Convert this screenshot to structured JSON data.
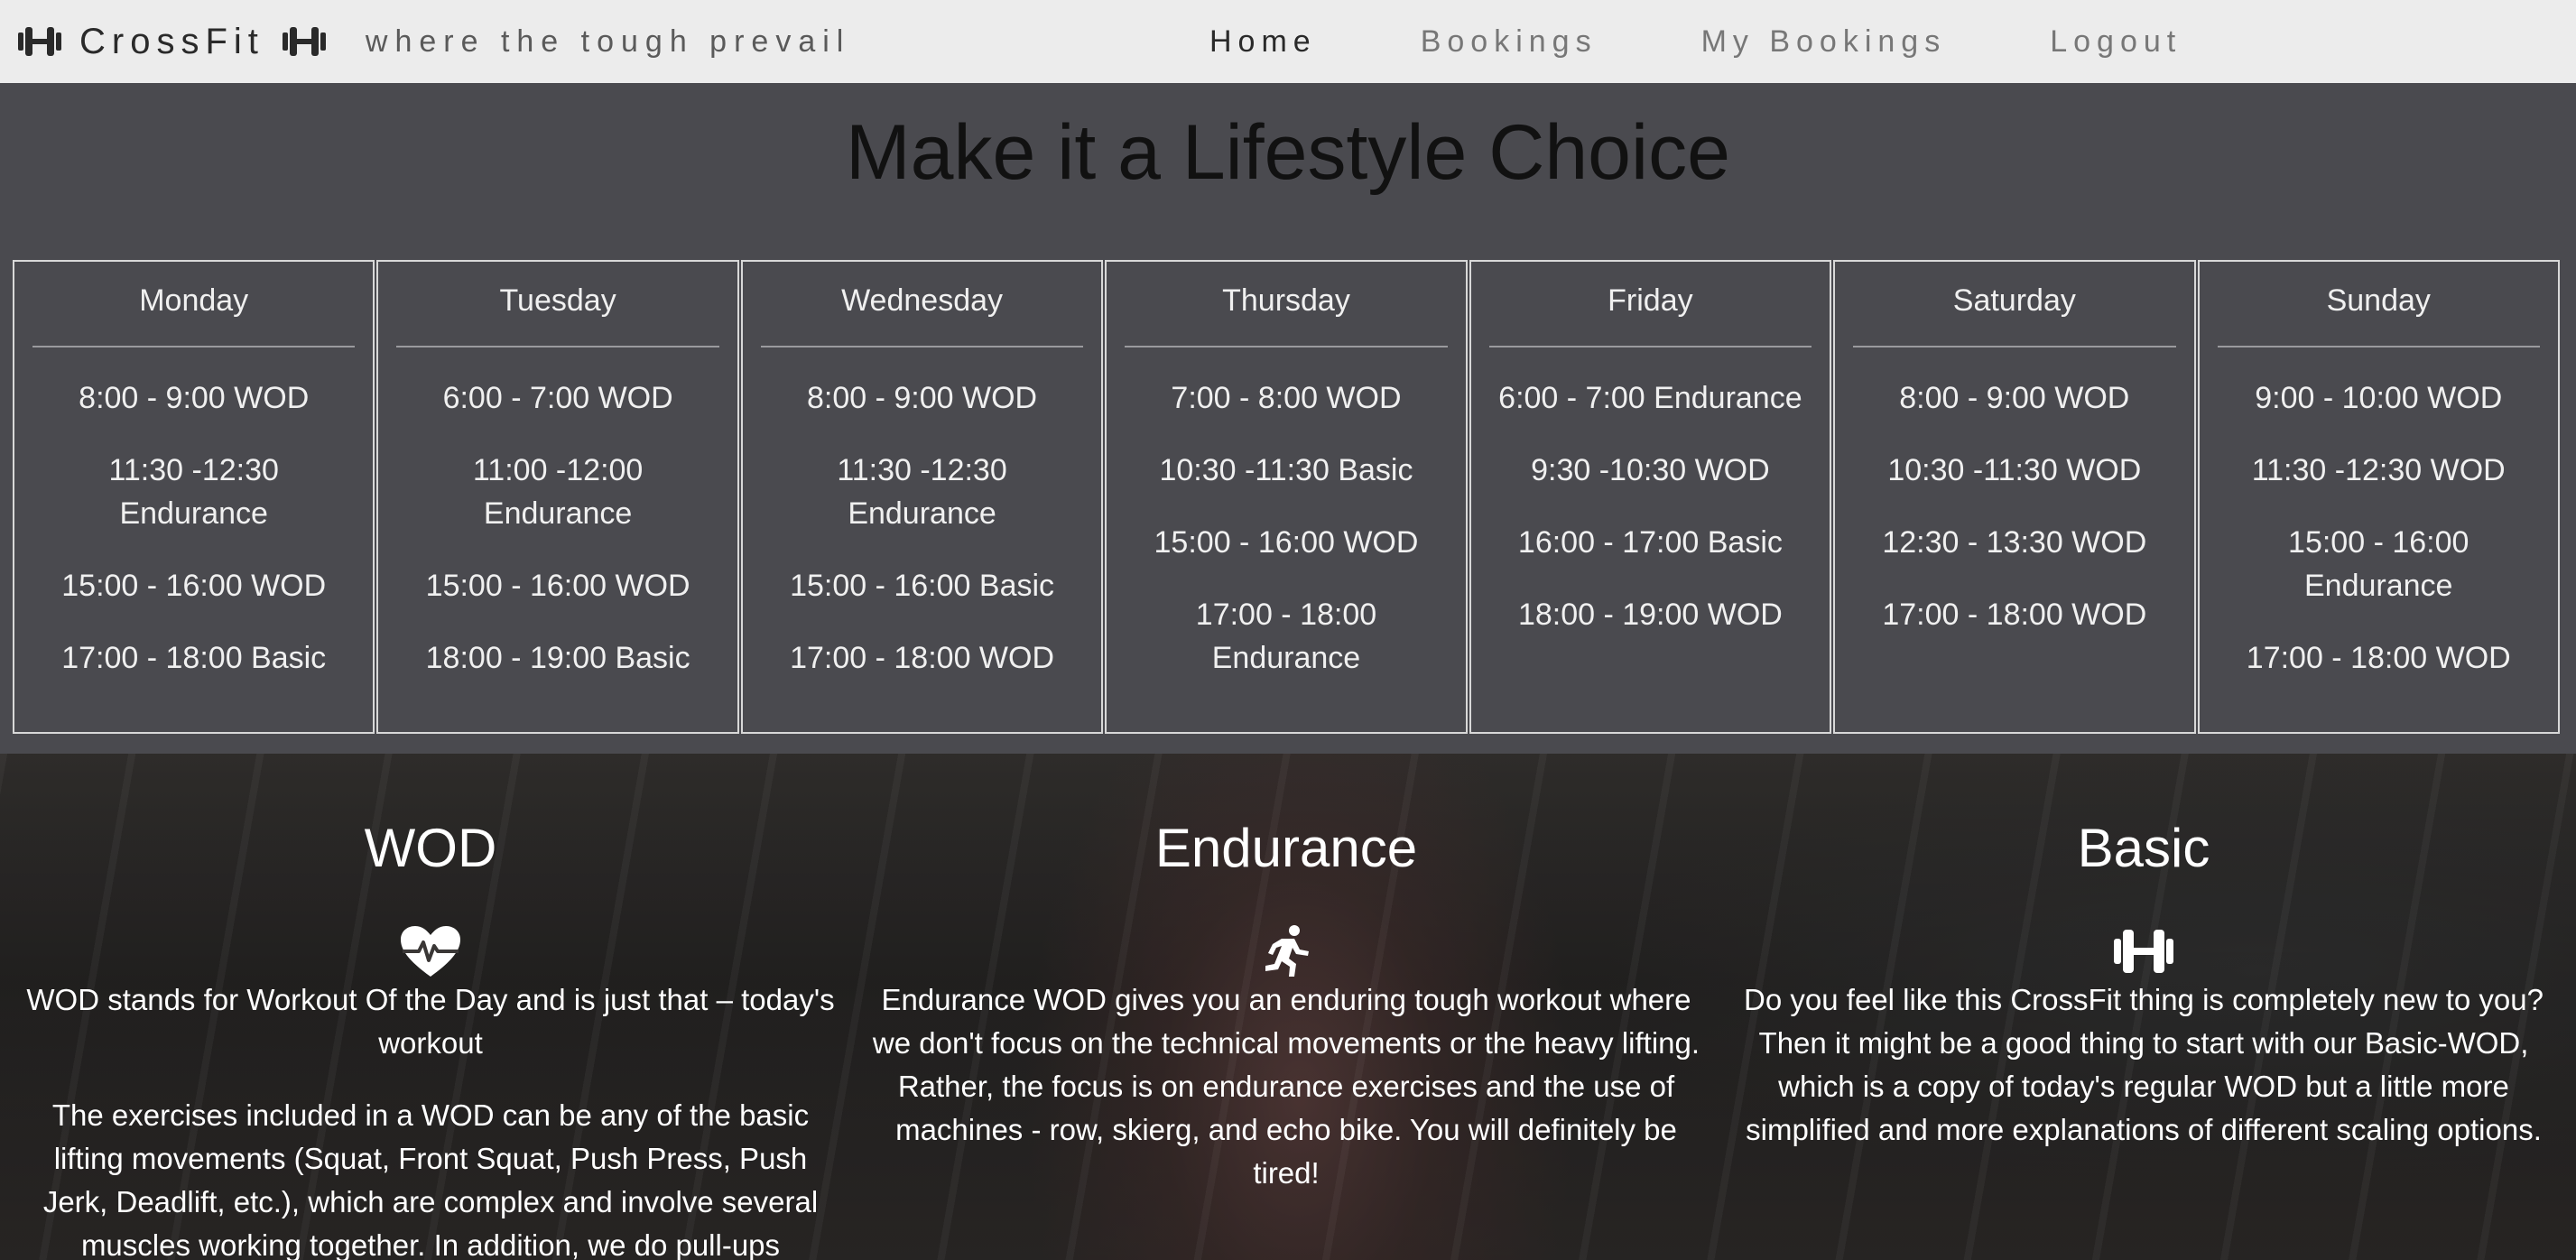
{
  "header": {
    "brand": "CrossFit",
    "brand_icon": "dumbbell-icon",
    "tagline": "where the tough prevail",
    "nav": [
      {
        "label": "Home",
        "active": true
      },
      {
        "label": "Bookings",
        "active": false
      },
      {
        "label": "My Bookings",
        "active": false
      },
      {
        "label": "Logout",
        "active": false
      }
    ]
  },
  "hero": {
    "title": "Make it a Lifestyle Choice"
  },
  "schedule": [
    {
      "day": "Monday",
      "slots": [
        "8:00 - 9:00 WOD",
        "11:30 -12:30 Endurance",
        "15:00 - 16:00 WOD",
        "17:00 - 18:00 Basic"
      ]
    },
    {
      "day": "Tuesday",
      "slots": [
        "6:00 - 7:00 WOD",
        "11:00 -12:00 Endurance",
        "15:00 - 16:00 WOD",
        "18:00 - 19:00 Basic"
      ]
    },
    {
      "day": "Wednesday",
      "slots": [
        "8:00 - 9:00 WOD",
        "11:30 -12:30 Endurance",
        "15:00 - 16:00 Basic",
        "17:00 - 18:00 WOD"
      ]
    },
    {
      "day": "Thursday",
      "slots": [
        "7:00 - 8:00 WOD",
        "10:30 -11:30 Basic",
        "15:00 - 16:00 WOD",
        "17:00 - 18:00 Endurance"
      ]
    },
    {
      "day": "Friday",
      "slots": [
        "6:00 - 7:00 Endurance",
        "9:30 -10:30 WOD",
        "16:00 - 17:00 Basic",
        "18:00 - 19:00 WOD"
      ]
    },
    {
      "day": "Saturday",
      "slots": [
        "8:00 - 9:00 WOD",
        "10:30 -11:30 WOD",
        "12:30 - 13:30 WOD",
        "17:00 - 18:00 WOD"
      ]
    },
    {
      "day": "Sunday",
      "slots": [
        "9:00 - 10:00 WOD",
        "11:30 -12:30 WOD",
        "15:00 - 16:00 Endurance",
        "17:00 - 18:00 WOD"
      ]
    }
  ],
  "features": {
    "wod": {
      "title": "WOD",
      "icon": "heartbeat-icon",
      "paragraphs": [
        "WOD stands for Workout Of the Day and is just that – today's workout",
        "The exercises included in a WOD can be any of the basic lifting movements (Squat, Front Squat, Push Press, Push Jerk, Deadlift, etc.), which are complex and involve several muscles working together. In addition, we do pull-ups"
      ]
    },
    "endurance": {
      "title": "Endurance",
      "icon": "running-icon",
      "paragraphs": [
        "Endurance WOD gives you an enduring tough workout where we don't focus on the technical movements or the heavy lifting. Rather, the focus is on endurance exercises and the use of machines - row, skierg, and echo bike. You will definitely be tired!"
      ]
    },
    "basic": {
      "title": "Basic",
      "icon": "dumbbell-icon",
      "paragraphs": [
        "Do you feel like this CrossFit thing is completely new to you? Then it might be a good thing to start with our Basic-WOD, which is a copy of today's regular WOD but a little more simplified and more explanations of different scaling options."
      ]
    }
  }
}
